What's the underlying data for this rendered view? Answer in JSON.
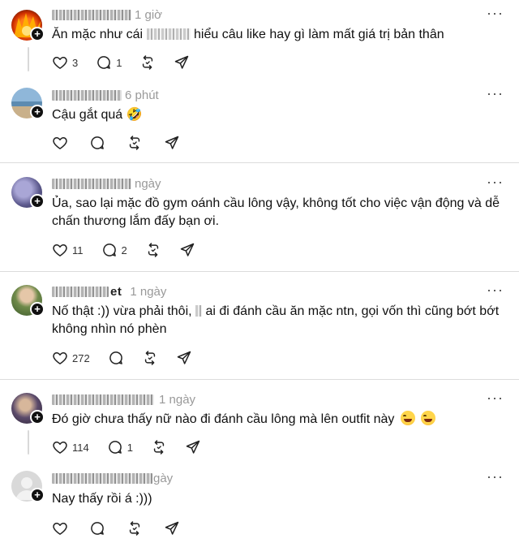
{
  "comments": [
    {
      "time": "1 giờ",
      "text_before": "Ăn mặc như cái",
      "text_after": "hiểu câu like hay gì làm mất giá trị bản thân",
      "likes": "3",
      "replies": "1",
      "has_thread_line": true
    },
    {
      "time": "6 phút",
      "text": "Cậu gắt quá 🤣",
      "likes": "",
      "replies": ""
    },
    {
      "time": "ngày",
      "text_line1": "Ủa, sao lại mặc đồ gym oánh cầu lông vậy, không tốt cho việc vận động và dễ",
      "text_line2": "chấn thương lắm đấy bạn ơi.",
      "likes": "11",
      "replies": "2"
    },
    {
      "username_suffix": "et",
      "time": "1 ngày",
      "text_line1_before": "Nố thật :)) vừa phải thôi,",
      "text_line1_after": "ai đi đánh cầu ăn mặc ntn, gọi vốn thì cũng bớt bớt",
      "text_line2": "không nhìn nó phèn",
      "likes": "272",
      "replies": ""
    },
    {
      "time": "1 ngày",
      "text": "Đó giờ chưa thấy nữ nào đi đánh cầu lông mà lên outfit này",
      "likes": "114",
      "replies": "1",
      "has_thread_line": true
    },
    {
      "time": "gày",
      "text": "Nay thấy rồi á :)))",
      "likes": "",
      "replies": ""
    }
  ],
  "icons": {
    "like": "heart-icon",
    "reply": "comment-icon",
    "repost": "repost-icon",
    "share": "send-icon",
    "more": "more-icon",
    "follow": "plus-icon"
  },
  "colors": {
    "text": "#101010",
    "muted": "#999999",
    "divider": "#dcdcdc"
  }
}
